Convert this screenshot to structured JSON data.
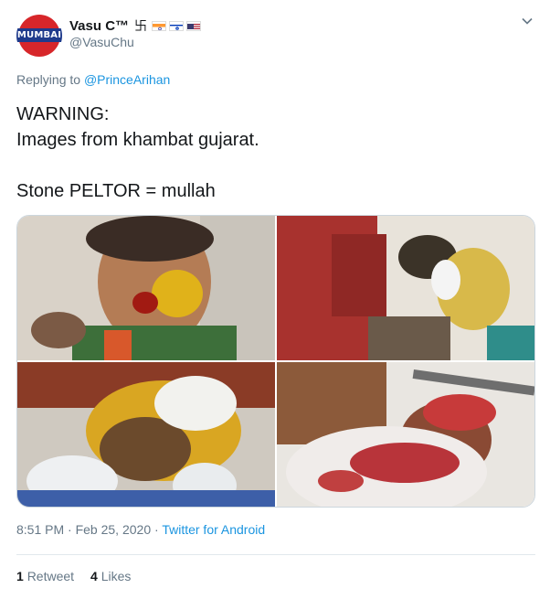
{
  "user": {
    "display_name": "Vasu C™",
    "handle": "@VasuChu",
    "avatar_text": "MUMBAI",
    "name_glyph": "卐"
  },
  "reply": {
    "prefix": "Replying to",
    "target": "@PrinceArihan"
  },
  "tweet": {
    "text": "WARNING:\nImages from khambat gujarat.\n\nStone PELTOR = mullah"
  },
  "meta": {
    "time": "8:51 PM",
    "separator": "·",
    "date": "Feb 25, 2020",
    "client": "Twitter for Android"
  },
  "stats": {
    "retweets_count": "1",
    "retweets_label": "Retweet",
    "likes_count": "4",
    "likes_label": "Likes"
  },
  "icons": {
    "menu": "chevron-down-icon",
    "flags": [
      "india-flag-icon",
      "israel-flag-icon",
      "usa-flag-icon"
    ]
  },
  "colors": {
    "link": "#1b95e0",
    "muted": "#657786",
    "text": "#14171a",
    "avatar_red": "#d7262a",
    "avatar_blue": "#1f3b8c"
  }
}
